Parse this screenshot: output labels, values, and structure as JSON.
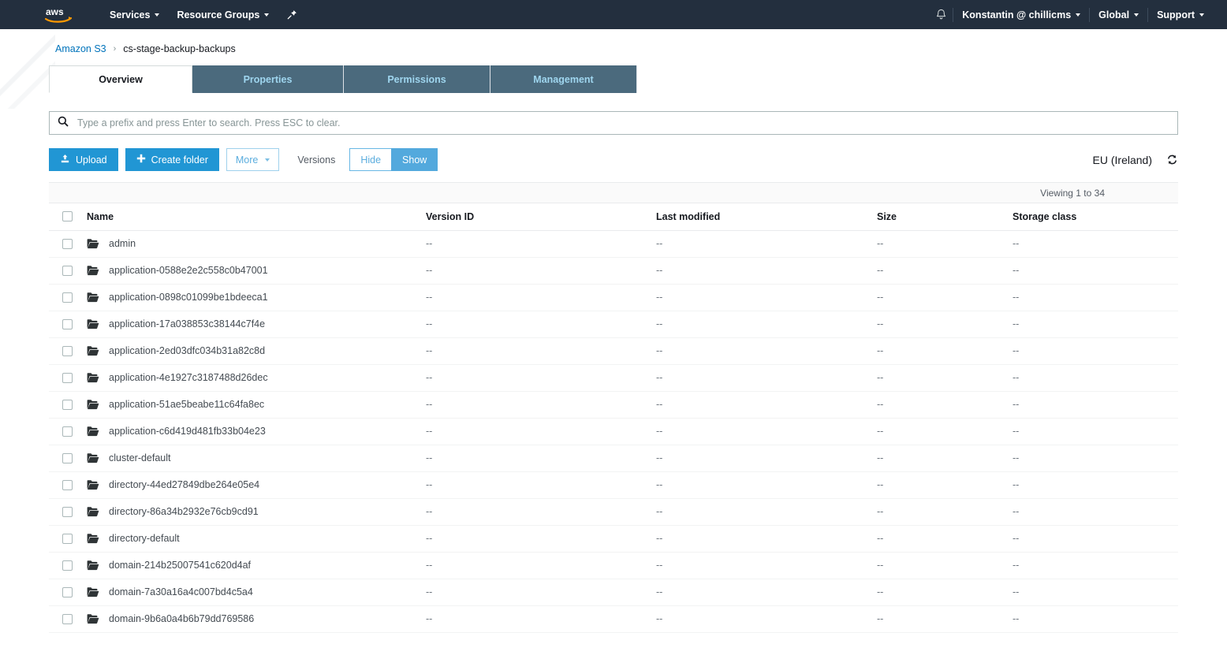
{
  "nav": {
    "logo": "aws-logo",
    "services": "Services",
    "resource_groups": "Resource Groups",
    "pin_icon": "pin-icon",
    "bell_icon": "bell-icon",
    "account": "Konstantin @ chillicms",
    "region_menu": "Global",
    "support": "Support"
  },
  "breadcrumb": {
    "root": "Amazon S3",
    "separator": "›",
    "current": "cs-stage-backup-backups"
  },
  "tabs": [
    {
      "label": "Overview",
      "active": true
    },
    {
      "label": "Properties",
      "active": false
    },
    {
      "label": "Permissions",
      "active": false
    },
    {
      "label": "Management",
      "active": false
    }
  ],
  "search": {
    "icon": "search-icon",
    "placeholder": "Type a prefix and press Enter to search. Press ESC to clear.",
    "value": ""
  },
  "toolbar": {
    "upload_label": "Upload",
    "upload_icon": "upload-icon",
    "create_folder_label": "Create folder",
    "create_folder_icon": "plus-icon",
    "more_label": "More",
    "more_icon": "chevron-down-icon",
    "versions_label": "Versions",
    "hide_label": "Hide",
    "show_label": "Show",
    "region": "EU (Ireland)",
    "refresh_icon": "refresh-icon"
  },
  "table": {
    "viewing": "Viewing 1 to 34",
    "columns": [
      "Name",
      "Version ID",
      "Last modified",
      "Size",
      "Storage class"
    ],
    "rows": [
      {
        "name": "admin",
        "version": "--",
        "modified": "--",
        "size": "--",
        "storage": "--"
      },
      {
        "name": "application-0588e2e2c558c0b47001",
        "version": "--",
        "modified": "--",
        "size": "--",
        "storage": "--"
      },
      {
        "name": "application-0898c01099be1bdeeca1",
        "version": "--",
        "modified": "--",
        "size": "--",
        "storage": "--"
      },
      {
        "name": "application-17a038853c38144c7f4e",
        "version": "--",
        "modified": "--",
        "size": "--",
        "storage": "--"
      },
      {
        "name": "application-2ed03dfc034b31a82c8d",
        "version": "--",
        "modified": "--",
        "size": "--",
        "storage": "--"
      },
      {
        "name": "application-4e1927c3187488d26dec",
        "version": "--",
        "modified": "--",
        "size": "--",
        "storage": "--"
      },
      {
        "name": "application-51ae5beabe11c64fa8ec",
        "version": "--",
        "modified": "--",
        "size": "--",
        "storage": "--"
      },
      {
        "name": "application-c6d419d481fb33b04e23",
        "version": "--",
        "modified": "--",
        "size": "--",
        "storage": "--"
      },
      {
        "name": "cluster-default",
        "version": "--",
        "modified": "--",
        "size": "--",
        "storage": "--"
      },
      {
        "name": "directory-44ed27849dbe264e05e4",
        "version": "--",
        "modified": "--",
        "size": "--",
        "storage": "--"
      },
      {
        "name": "directory-86a34b2932e76cb9cd91",
        "version": "--",
        "modified": "--",
        "size": "--",
        "storage": "--"
      },
      {
        "name": "directory-default",
        "version": "--",
        "modified": "--",
        "size": "--",
        "storage": "--"
      },
      {
        "name": "domain-214b25007541c620d4af",
        "version": "--",
        "modified": "--",
        "size": "--",
        "storage": "--"
      },
      {
        "name": "domain-7a30a16a4c007bd4c5a4",
        "version": "--",
        "modified": "--",
        "size": "--",
        "storage": "--"
      },
      {
        "name": "domain-9b6a0a4b6b79dd769586",
        "version": "--",
        "modified": "--",
        "size": "--",
        "storage": "--"
      }
    ]
  },
  "colors": {
    "nav_bg": "#232f3e",
    "accent_blue": "#2196d4",
    "link_blue": "#0073bb",
    "tab_inactive_bg": "#4b6a7d",
    "tab_inactive_text": "#9fd6ef"
  }
}
